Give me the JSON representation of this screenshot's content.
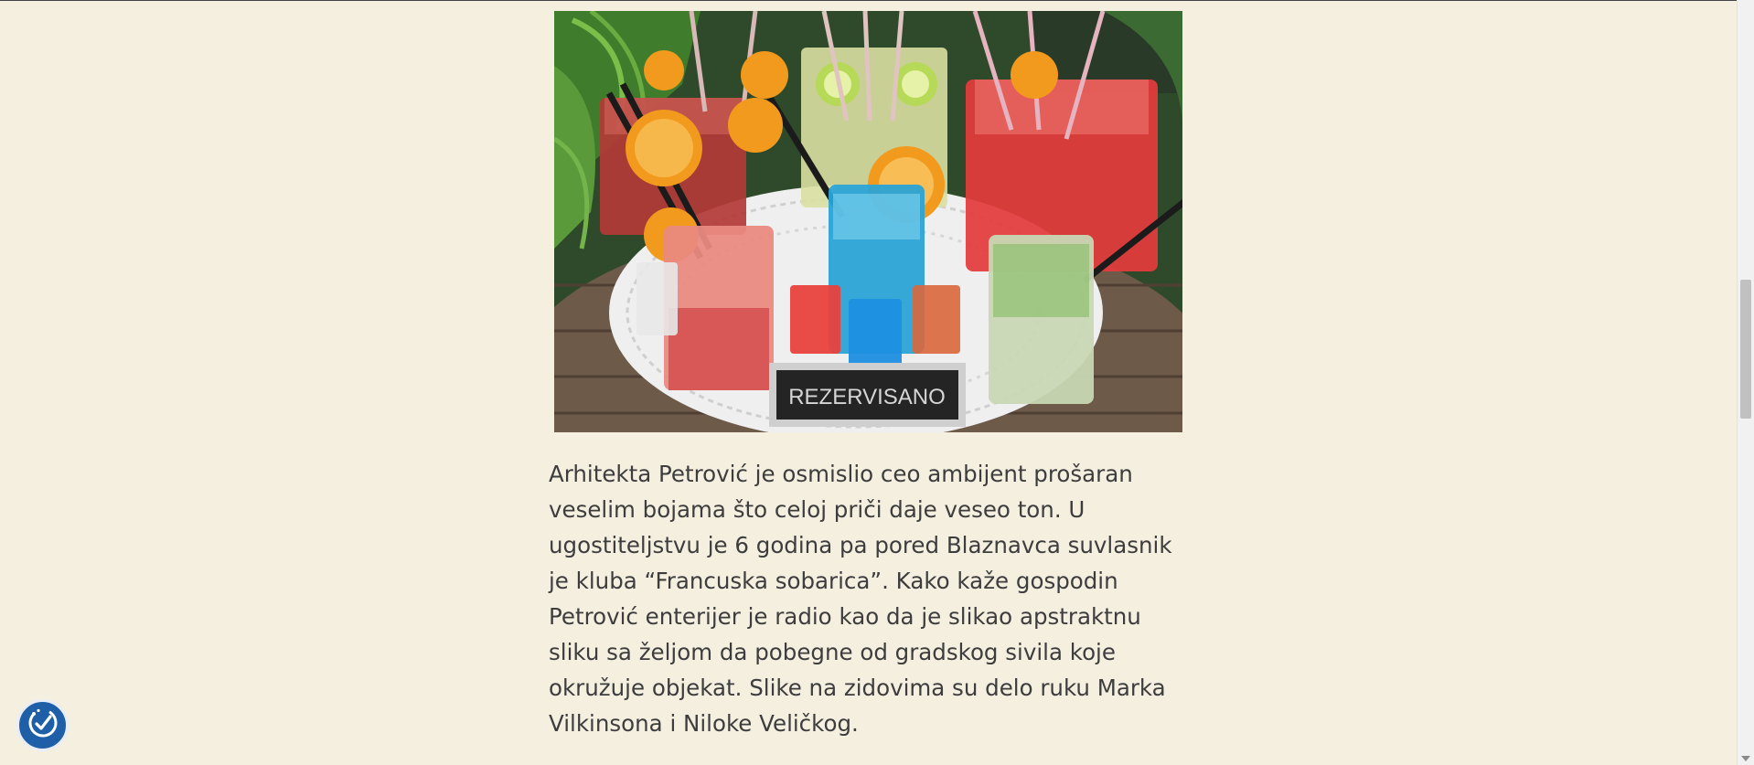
{
  "article": {
    "photo": {
      "sign_text": "REZERVISANO",
      "alt": "Šareni kokteli sa narandžom i limetom na stolu"
    },
    "paragraph": "Arhitekta Petrović je osmislio ceo ambijent prošaran veselim bojama što celoj priči daje veseo ton. U ugostiteljstvu je 6 godina pa pored Blaznavca suvlasnik je kluba “Francuska sobarica”. Kako kaže gospodin Petrović enterijer je radio kao da je slikao apstraktnu sliku sa željom da pobegne od gradskog sivila koje okružuje objekat. Slike na zidovima su delo ruku Marka Vilkinsona i Niloke Veličkog."
  },
  "colors": {
    "page_background": "#f5efe0",
    "text": "#3d3d3d",
    "accessibility_button": "#1e5fa8"
  },
  "icons": {
    "accessibility": "accessibility-icon"
  }
}
